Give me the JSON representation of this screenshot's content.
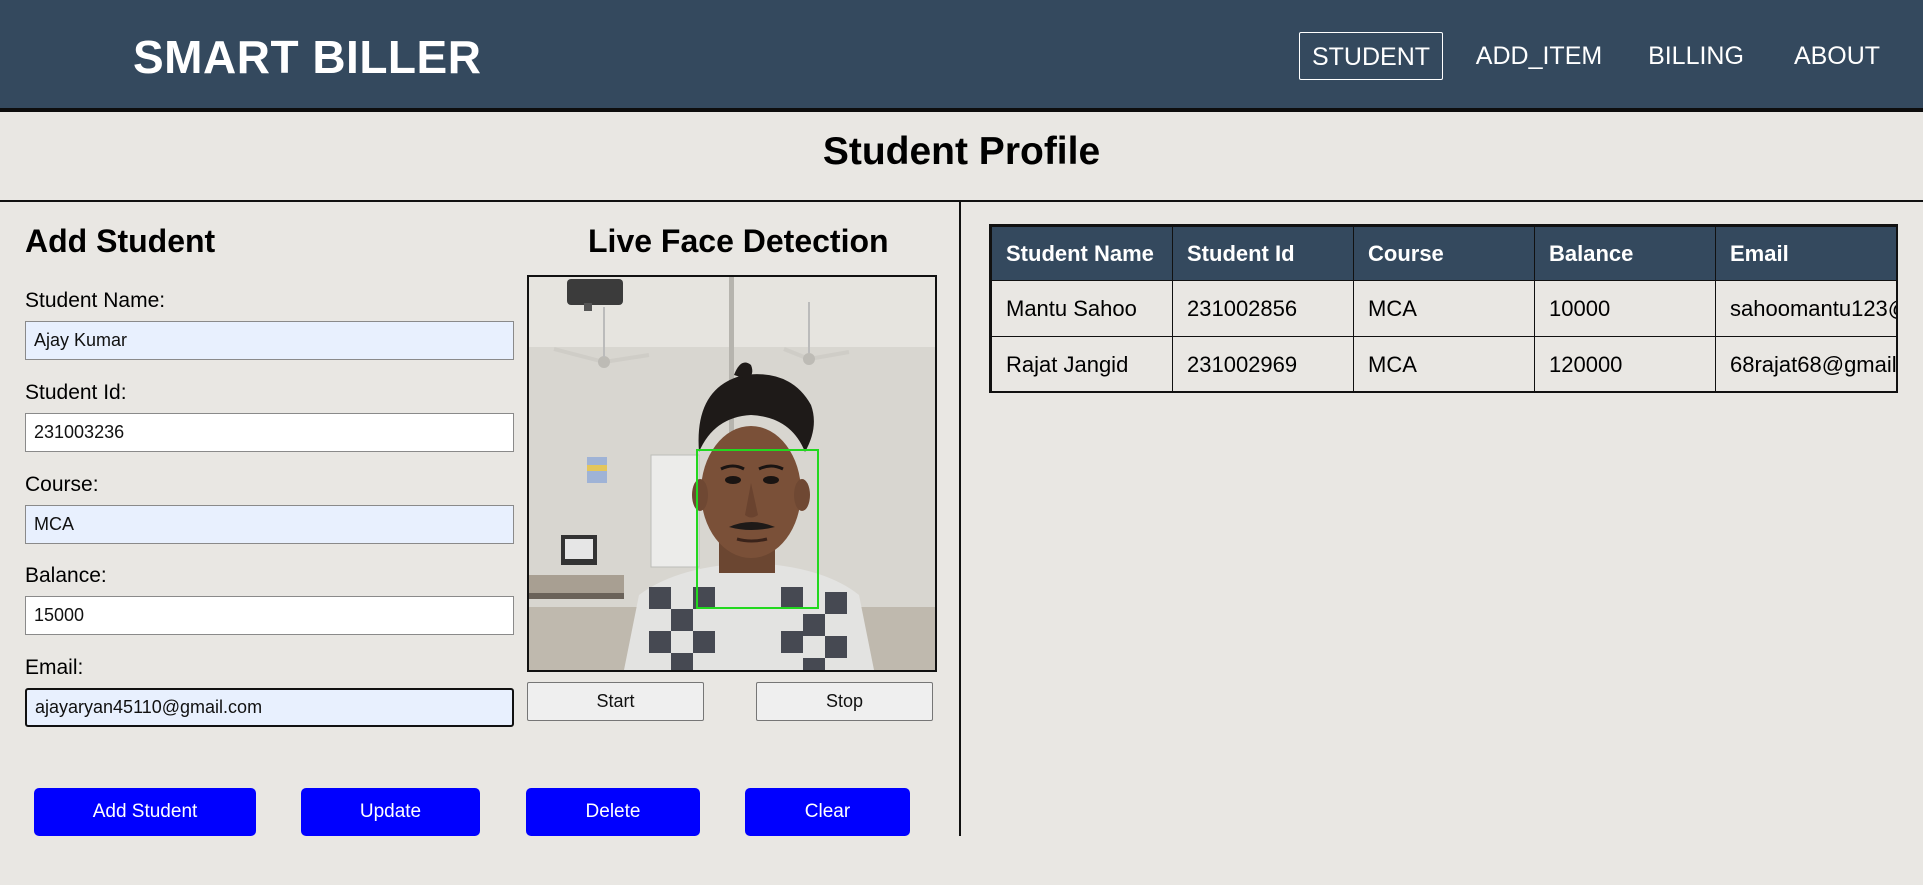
{
  "header": {
    "brand": "SMART BILLER",
    "nav": [
      {
        "label": "STUDENT",
        "active": true
      },
      {
        "label": "ADD_ITEM",
        "active": false
      },
      {
        "label": "BILLING",
        "active": false
      },
      {
        "label": "ABOUT",
        "active": false
      }
    ]
  },
  "page_title": "Student Profile",
  "form": {
    "heading": "Add Student",
    "fields": [
      {
        "label": "Student Name:",
        "value": "Ajay Kumar"
      },
      {
        "label": "Student Id:",
        "value": "231003236"
      },
      {
        "label": "Course:",
        "value": "MCA"
      },
      {
        "label": "Balance:",
        "value": "15000"
      },
      {
        "label": "Email:",
        "value": "ajayaryan45110@gmail.com"
      }
    ]
  },
  "camera": {
    "heading": "Live Face Detection",
    "start_label": "Start",
    "stop_label": "Stop"
  },
  "actions": {
    "add": "Add Student",
    "update": "Update",
    "delete": "Delete",
    "clear": "Clear"
  },
  "table": {
    "columns": [
      "Student Name",
      "Student Id",
      "Course",
      "Balance",
      "Email"
    ],
    "rows": [
      [
        "Mantu Sahoo",
        "231002856",
        "MCA",
        "10000",
        "sahoomantu123@"
      ],
      [
        "Rajat Jangid",
        "231002969",
        "MCA",
        "120000",
        "68rajat68@gmail."
      ]
    ]
  },
  "colors": {
    "header_bg": "#34495e",
    "action_button": "#0000ff",
    "face_box": "#22d81f",
    "page_bg": "#e9e7e3"
  }
}
